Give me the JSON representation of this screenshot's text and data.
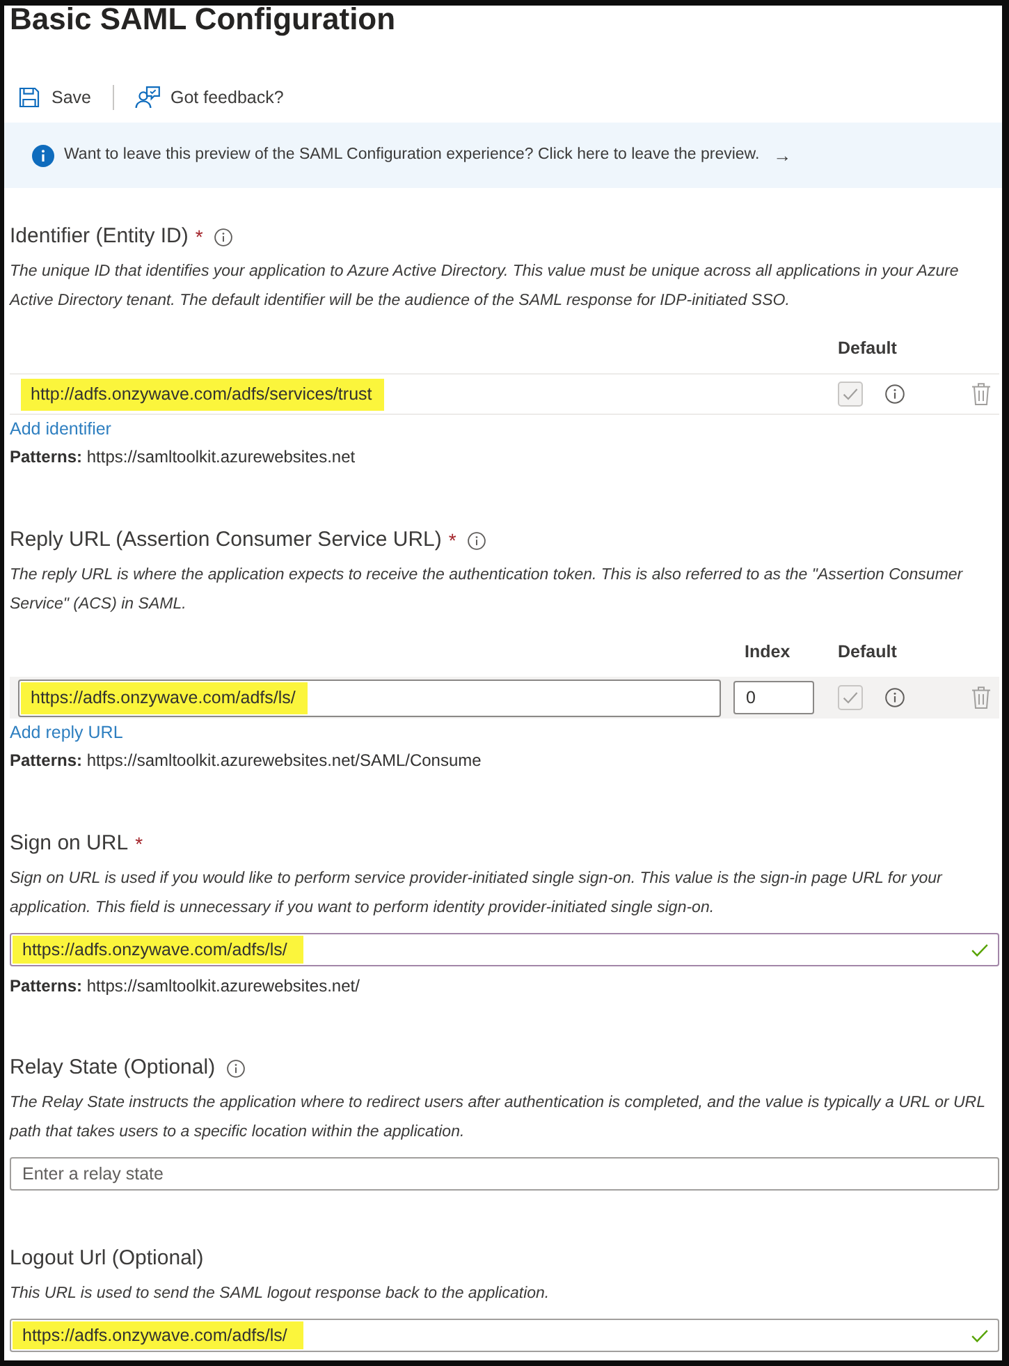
{
  "title": "Basic SAML Configuration",
  "toolbar": [
    {
      "kind": "save",
      "label": "Save"
    },
    {
      "kind": "feedback",
      "label": "Got feedback?"
    }
  ],
  "banner": {
    "text": "Want to leave this preview of the SAML Configuration experience? Click here to leave the preview.",
    "arrow": "→"
  },
  "sections": [
    {
      "kind": "table",
      "label": "Identifier (Entity ID)",
      "required_mark": "*",
      "info_icon": true,
      "description": "The unique ID that identifies your application to Azure Active Directory. This value must be unique across all applications in your Azure Active Directory tenant. The default identifier will be the audience of the SAML response for IDP-initiated SSO.",
      "columns": [
        {
          "kind": "default",
          "label": "Default"
        }
      ],
      "rows": [
        {
          "value": "http://adfs.onzywave.com/adfs/services/trust",
          "highlighted": true,
          "hovered": false,
          "default_checked": true,
          "default_disabled": true
        }
      ],
      "add_link": "Add identifier",
      "patterns": "**Patterns:** https://samltoolkit.azurewebsites.net"
    },
    {
      "kind": "table",
      "label": "Reply URL (Assertion Consumer Service URL)",
      "required_mark": "*",
      "info_icon": true,
      "description": "The reply URL is where the application expects to receive the authentication token. This is also referred to as the \"Assertion Consumer Service\" (ACS) in SAML.",
      "columns": [
        {
          "kind": "index",
          "label": "Index"
        },
        {
          "kind": "default",
          "label": "Default"
        }
      ],
      "rows": [
        {
          "value": "https://adfs.onzywave.com/adfs/ls/",
          "index": "0",
          "highlighted": true,
          "hovered": true,
          "default_checked": true,
          "default_disabled": true
        }
      ],
      "add_link": "Add reply URL",
      "patterns": "**Patterns:** https://samltoolkit.azurewebsites.net/SAML/Consume"
    },
    {
      "kind": "single",
      "label": "Sign on URL",
      "required_mark": "*",
      "info_icon": false,
      "description": "Sign on URL is used if you would like to perform service provider-initiated single sign-on. This value is the sign-in page URL for your application. This field is unnecessary if you want to perform identity provider-initiated single sign-on.",
      "field": {
        "value": "https://adfs.onzywave.com/adfs/ls/",
        "highlighted": true,
        "focused": true,
        "valid": true
      },
      "patterns": "**Patterns:** https://samltoolkit.azurewebsites.net/"
    },
    {
      "kind": "single",
      "label": "Relay State (Optional)",
      "info_icon": true,
      "description": "The Relay State instructs the application where to redirect users after authentication is completed, and the value is typically a URL or URL path that takes users to a specific location within the application.",
      "field": {
        "placeholder": "Enter a relay state",
        "focused": false,
        "valid": false
      }
    },
    {
      "kind": "single",
      "label": "Logout Url (Optional)",
      "info_icon": false,
      "description": "This URL is used to send the SAML logout response back to the application.",
      "field": {
        "value": "https://adfs.onzywave.com/adfs/ls/",
        "highlighted": true,
        "focused": false,
        "valid": true
      }
    }
  ]
}
